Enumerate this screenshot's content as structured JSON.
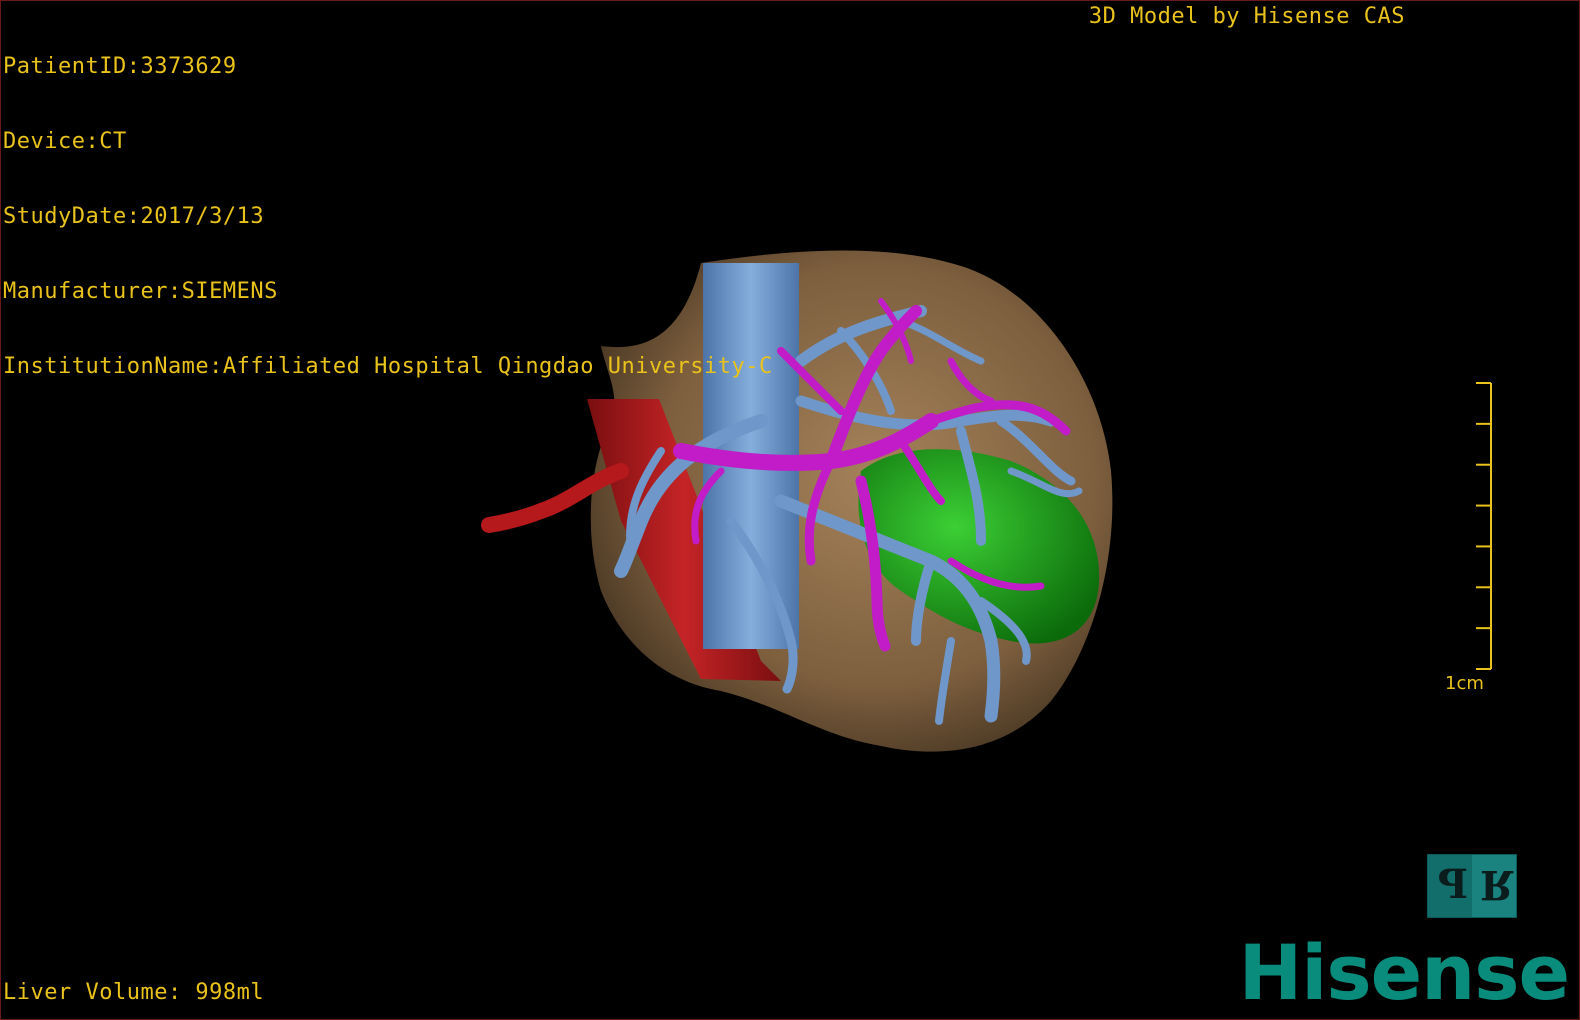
{
  "header_info": [
    "PatientID:3373629",
    "Device:CT",
    "StudyDate:2017/3/13",
    "Manufacturer:SIEMENS",
    "InstitutionName:Affiliated Hospital Qingdao University-C"
  ],
  "branding": "3D Model by Hisense CAS",
  "liver_volume": "Liver Volume: 998ml",
  "scale_bar": {
    "label": "1cm",
    "ticks": 8
  },
  "orientation_cube": {
    "left_glyph": "P",
    "right_glyph": "R"
  },
  "logo_text": "Hisense",
  "colors": {
    "overlay_text": "#e9c21b",
    "liver": "#8a6a45",
    "hepatic_vein": "#6f97c9",
    "portal_vein": "#c21cc8",
    "artery": "#b5191b",
    "tumor": "#1fa61b",
    "logo": "#0a8c7c",
    "orientation_cube": "#126e6b"
  }
}
